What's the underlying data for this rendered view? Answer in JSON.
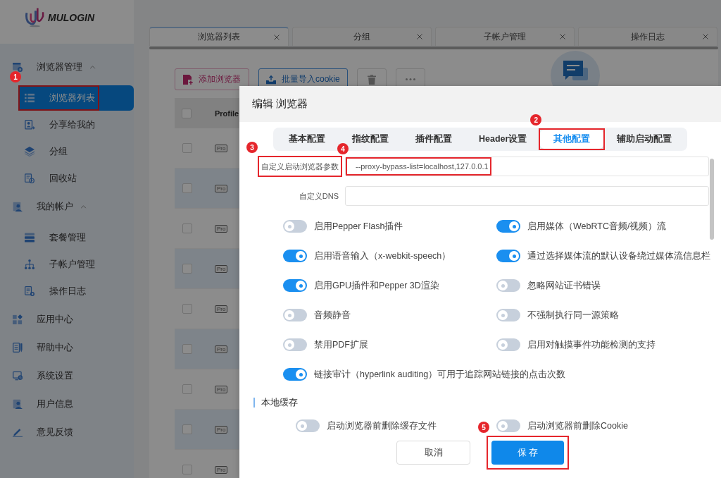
{
  "logo": {
    "text": "MULOGIN"
  },
  "sidebar": {
    "items": [
      {
        "kind": "group",
        "label": "浏览器管理",
        "expanded": true,
        "selected": false,
        "children": [
          {
            "label": "浏览器列表",
            "selected": true,
            "callout": "1"
          },
          {
            "label": "分享给我的",
            "selected": false
          },
          {
            "label": "分组",
            "selected": false
          },
          {
            "label": "回收站",
            "selected": false
          }
        ]
      },
      {
        "kind": "group",
        "label": "我的帐户",
        "expanded": true,
        "selected": false,
        "children": [
          {
            "label": "套餐管理",
            "selected": false
          },
          {
            "label": "子帐户管理",
            "selected": false
          },
          {
            "label": "操作日志",
            "selected": false
          }
        ]
      },
      {
        "kind": "link",
        "label": "应用中心",
        "selected": false
      },
      {
        "kind": "link",
        "label": "帮助中心",
        "selected": false
      },
      {
        "kind": "link",
        "label": "系统设置",
        "selected": false
      },
      {
        "kind": "link",
        "label": "用户信息",
        "selected": false
      },
      {
        "kind": "link",
        "label": "意见反馈",
        "selected": false
      }
    ]
  },
  "page_tabs": [
    {
      "label": "浏览器列表",
      "selected": true
    },
    {
      "label": "分组",
      "selected": false
    },
    {
      "label": "子帐户管理",
      "selected": false
    },
    {
      "label": "操作日志",
      "selected": false
    }
  ],
  "toolbar": {
    "buttons": [
      {
        "kind": "add",
        "label": "添加浏览器"
      },
      {
        "kind": "import",
        "label": "批量导入cookie"
      },
      {
        "kind": "delete"
      },
      {
        "kind": "more"
      }
    ]
  },
  "table": {
    "all_checked": false,
    "columns": [
      "Profile"
    ],
    "rows": [
      {
        "checked": false,
        "tag": "Pro"
      },
      {
        "checked": false,
        "tag": "Pro"
      },
      {
        "checked": false,
        "tag": "Pro"
      },
      {
        "checked": false,
        "tag": "Pro"
      },
      {
        "checked": false,
        "tag": "Pro"
      },
      {
        "checked": false,
        "tag": "Pro"
      },
      {
        "checked": false,
        "tag": "Pro"
      },
      {
        "checked": false,
        "tag": "Pro"
      },
      {
        "checked": false,
        "tag": "Pro"
      }
    ]
  },
  "dialog": {
    "title": "编辑 浏览器",
    "tabs": [
      {
        "label": "基本配置",
        "selected": false
      },
      {
        "label": "指纹配置",
        "selected": false
      },
      {
        "label": "插件配置",
        "selected": false
      },
      {
        "label": "Header设置",
        "selected": false
      },
      {
        "label": "其他配置",
        "selected": true,
        "callout": "2"
      },
      {
        "label": "辅助启动配置",
        "selected": false
      }
    ],
    "fields": [
      {
        "label": "自定义启动浏览器参数",
        "label_callout": "3",
        "value": "--proxy-bypass-list=localhost,127.0.0.1",
        "value_callout": "4"
      },
      {
        "label": "自定义DNS"
      }
    ],
    "toggles": [
      {
        "label": "启用Pepper Flash插件",
        "on": false
      },
      {
        "label": "启用媒体（WebRTC音频/视频）流",
        "on": true
      },
      {
        "label": "启用语音输入（x-webkit-speech）",
        "on": true
      },
      {
        "label": "通过选择媒体流的默认设备绕过媒体流信息栏",
        "on": true
      },
      {
        "label": "启用GPU插件和Pepper 3D渲染",
        "on": true
      },
      {
        "label": "忽略网站证书错误",
        "on": false
      },
      {
        "label": "音频静音",
        "on": false
      },
      {
        "label": "不强制执行同一源策略",
        "on": false
      },
      {
        "label": "禁用PDF扩展",
        "on": false
      },
      {
        "label": "启用对触摸事件功能检测的支持",
        "on": false
      },
      {
        "label": "链接审计（hyperlink auditing）可用于追踪网站链接的点击次数",
        "on": true
      }
    ],
    "sections": [
      {
        "title": "本地缓存",
        "toggles": [
          {
            "label": "启动浏览器前删除缓存文件",
            "on": false
          },
          {
            "label": "启动浏览器前删除Cookie",
            "on": false
          }
        ]
      }
    ],
    "buttons": [
      {
        "kind": "secondary",
        "label": "取消"
      },
      {
        "kind": "primary",
        "label": "保 存",
        "callout": "5"
      }
    ]
  }
}
